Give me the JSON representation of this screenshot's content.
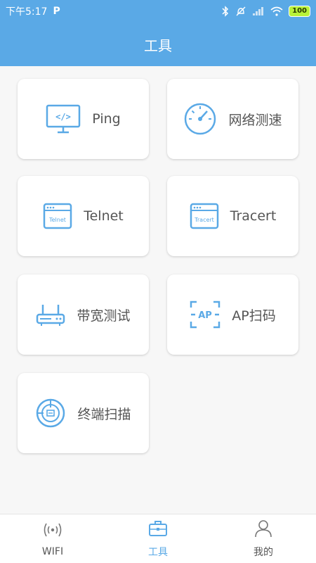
{
  "status_bar": {
    "time": "下午5:17",
    "battery": "100",
    "icons": [
      "p-icon",
      "bluetooth-icon",
      "alarm-off-icon",
      "signal-icon",
      "wifi-icon",
      "battery-icon"
    ]
  },
  "app_bar": {
    "title": "工具"
  },
  "colors": {
    "accent": "#5aa9e6",
    "card_bg": "#ffffff",
    "page_bg": "#f7f7f7",
    "text": "#555555"
  },
  "tools": [
    {
      "label": "Ping",
      "icon": "code-monitor-icon"
    },
    {
      "label": "网络测速",
      "icon": "speedometer-icon"
    },
    {
      "label": "Telnet",
      "icon": "telnet-window-icon",
      "icon_text": "Telnet"
    },
    {
      "label": "Tracert",
      "icon": "tracert-window-icon",
      "icon_text": "Tracert"
    },
    {
      "label": "带宽测试",
      "icon": "router-icon"
    },
    {
      "label": "AP扫码",
      "icon": "ap-scan-icon",
      "icon_text": "AP"
    },
    {
      "label": "终端扫描",
      "icon": "radar-scan-icon"
    }
  ],
  "tab_bar": {
    "tabs": [
      {
        "label": "WIFI",
        "icon": "wifi-signal-icon",
        "active": false
      },
      {
        "label": "工具",
        "icon": "toolbox-icon",
        "active": true
      },
      {
        "label": "我的",
        "icon": "user-icon",
        "active": false
      }
    ]
  }
}
